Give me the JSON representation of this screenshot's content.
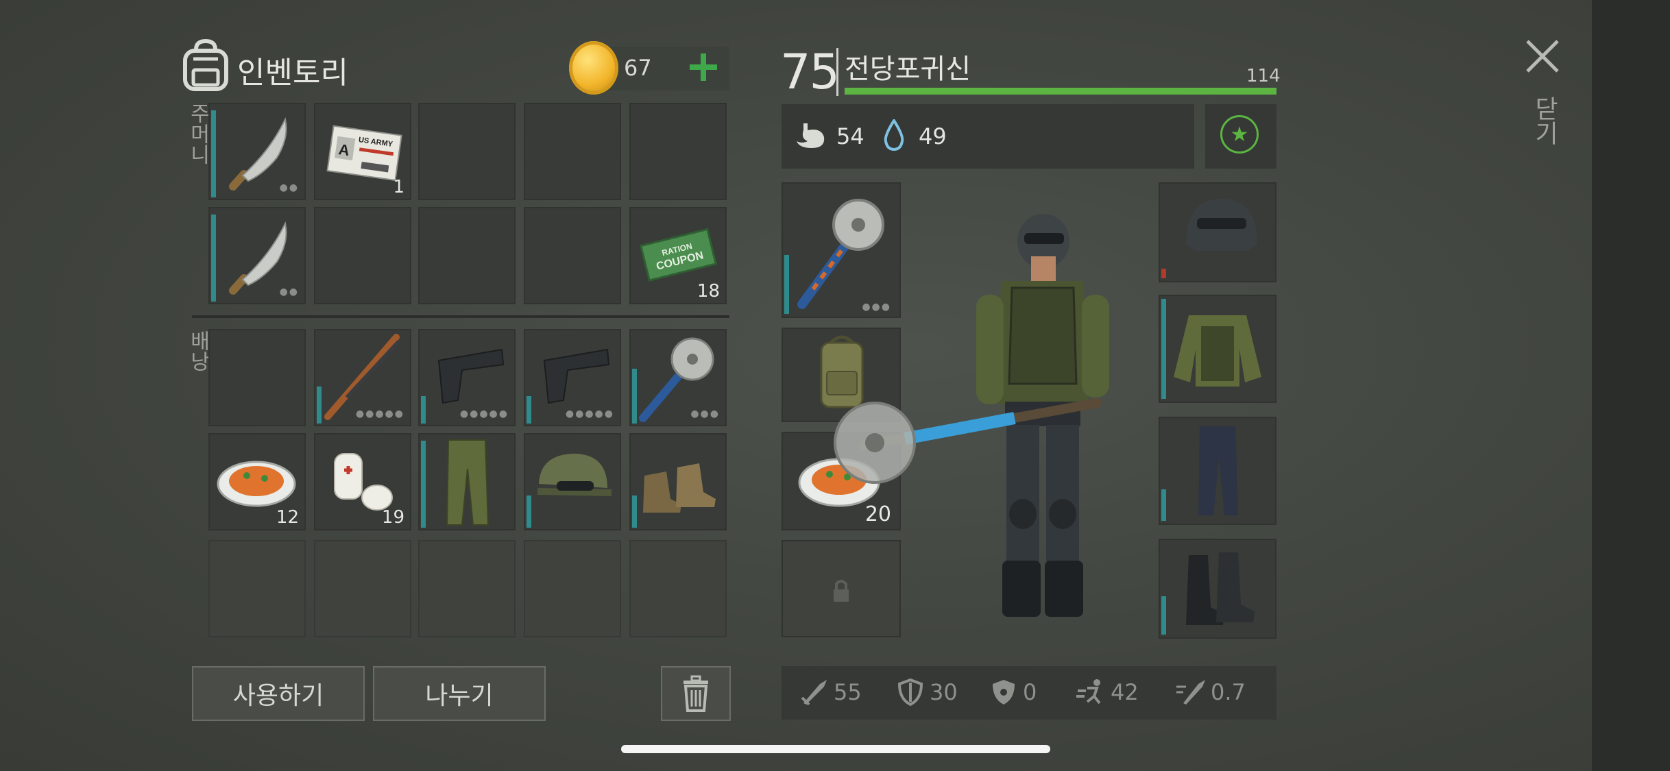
{
  "inventory": {
    "title": "인벤토리",
    "coins": "67",
    "pocket_label": "주머니",
    "backpack_label": "배낭",
    "slots": [
      {
        "row": 0,
        "col": 0,
        "item": "machete",
        "count": "",
        "dots": "●●",
        "durability": 0.95
      },
      {
        "row": 0,
        "col": 1,
        "item": "us-army-id-card",
        "count": "1",
        "dots": "",
        "durability": 0
      },
      {
        "row": 0,
        "col": 2,
        "item": "",
        "count": "",
        "dots": "",
        "durability": 0
      },
      {
        "row": 0,
        "col": 3,
        "item": "",
        "count": "",
        "dots": "",
        "durability": 0
      },
      {
        "row": 0,
        "col": 4,
        "item": "",
        "count": "",
        "dots": "",
        "durability": 0
      },
      {
        "row": 1,
        "col": 0,
        "item": "machete",
        "count": "",
        "dots": "●●",
        "durability": 0.95
      },
      {
        "row": 1,
        "col": 1,
        "item": "",
        "count": "",
        "dots": "",
        "durability": 0
      },
      {
        "row": 1,
        "col": 2,
        "item": "",
        "count": "",
        "dots": "",
        "durability": 0
      },
      {
        "row": 1,
        "col": 3,
        "item": "",
        "count": "",
        "dots": "",
        "durability": 0
      },
      {
        "row": 1,
        "col": 4,
        "item": "ration-coupon",
        "count": "18",
        "dots": "",
        "durability": 0
      },
      {
        "row": 2,
        "col": 0,
        "item": "",
        "count": "",
        "dots": "",
        "durability": 0
      },
      {
        "row": 2,
        "col": 1,
        "item": "shotgun",
        "count": "",
        "dots": "●●●●●",
        "durability": 0.4
      },
      {
        "row": 2,
        "col": 2,
        "item": "pistol",
        "count": "",
        "dots": "●●●●●",
        "durability": 0.3
      },
      {
        "row": 2,
        "col": 3,
        "item": "pistol",
        "count": "",
        "dots": "●●●●●",
        "durability": 0.3
      },
      {
        "row": 2,
        "col": 4,
        "item": "saw-blade-club",
        "count": "",
        "dots": "●●●",
        "durability": 0.6
      },
      {
        "row": 3,
        "col": 0,
        "item": "food-plate",
        "count": "12",
        "dots": "",
        "durability": 0
      },
      {
        "row": 3,
        "col": 1,
        "item": "bandage",
        "count": "19",
        "dots": "",
        "durability": 0
      },
      {
        "row": 3,
        "col": 2,
        "item": "camo-pants",
        "count": "",
        "dots": "",
        "durability": 0.95
      },
      {
        "row": 3,
        "col": 3,
        "item": "camo-cap",
        "count": "",
        "dots": "",
        "durability": 0.35
      },
      {
        "row": 3,
        "col": 4,
        "item": "boots",
        "count": "",
        "dots": "",
        "durability": 0.35
      },
      {
        "row": 4,
        "col": 0,
        "item": "",
        "count": "",
        "dots": "",
        "durability": 0
      },
      {
        "row": 4,
        "col": 1,
        "item": "",
        "count": "",
        "dots": "",
        "durability": 0
      },
      {
        "row": 4,
        "col": 2,
        "item": "",
        "count": "",
        "dots": "",
        "durability": 0
      },
      {
        "row": 4,
        "col": 3,
        "item": "",
        "count": "",
        "dots": "",
        "durability": 0
      },
      {
        "row": 4,
        "col": 4,
        "item": "",
        "count": "",
        "dots": "",
        "durability": 0
      }
    ],
    "card_text": {
      "line1": "US ARMY",
      "letter": "A"
    },
    "coupon_text": {
      "line1": "RATION",
      "line2": "COUPON"
    }
  },
  "actions": {
    "use_label": "사용하기",
    "split_label": "나누기",
    "trash_icon": "trash-icon"
  },
  "character": {
    "level": "75",
    "name": "전당포귀신",
    "xp_max": "114",
    "xp_fraction": 1.0,
    "hunger": "54",
    "thirst": "49",
    "equipment": {
      "weapon_count": "",
      "quick_slot_count": "20"
    }
  },
  "combat_stats": {
    "attack": "55",
    "defense": "30",
    "radiation": "0",
    "speed": "42",
    "attack_speed": "0.7"
  },
  "close": {
    "label": "닫기",
    "icon": "close-icon"
  },
  "colors": {
    "accent_green": "#5cb543",
    "durability_teal": "#2f8b8c",
    "danger_red": "#c0392b"
  }
}
